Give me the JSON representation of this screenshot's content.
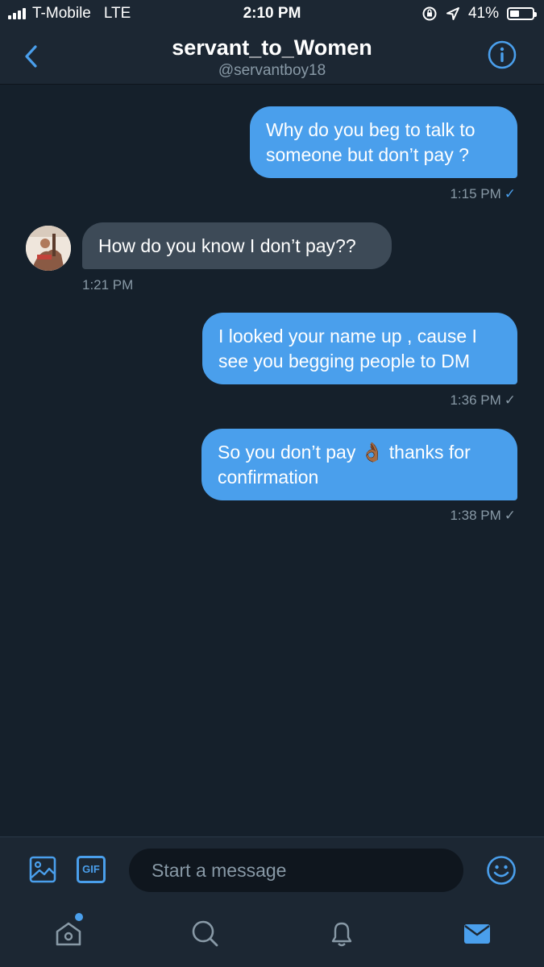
{
  "status_bar": {
    "carrier": "T-Mobile",
    "network": "LTE",
    "time": "2:10 PM",
    "battery": "41%",
    "battery_level": 0.41
  },
  "header": {
    "display_name": "servant_to_Women",
    "handle": "@servantboy18"
  },
  "messages": [
    {
      "direction": "outgoing",
      "lines": [
        "Why do you beg to talk to",
        "someone but don’t pay ?"
      ],
      "time": "1:15 PM",
      "check": "✓",
      "check_color": "#4a9fec"
    },
    {
      "direction": "incoming",
      "lines": [
        "How do you know I don’t pay??"
      ],
      "time": "1:21 PM"
    },
    {
      "direction": "outgoing",
      "lines": [
        "I looked your name up , cause I",
        "see you begging people to DM"
      ],
      "time": "1:36 PM",
      "check": "✓",
      "check_color": "#8899a6"
    },
    {
      "direction": "outgoing",
      "lines": [
        "So you don’t pay 👌🏾 thanks for",
        "confirmation"
      ],
      "time": "1:38 PM",
      "check": "✓",
      "check_color": "#8899a6"
    }
  ],
  "composer": {
    "placeholder": "Start a message",
    "gif_label": "GIF"
  },
  "tabs": [
    {
      "name": "home",
      "icon": "home-icon",
      "has_dot": true
    },
    {
      "name": "search",
      "icon": "search-icon"
    },
    {
      "name": "notifications",
      "icon": "bell-icon"
    },
    {
      "name": "messages",
      "icon": "envelope-icon",
      "active": true
    }
  ],
  "colors": {
    "background": "#15202b",
    "accent": "#4a9fec",
    "incoming_bubble": "#3d4a57",
    "muted_text": "#8899a6"
  }
}
